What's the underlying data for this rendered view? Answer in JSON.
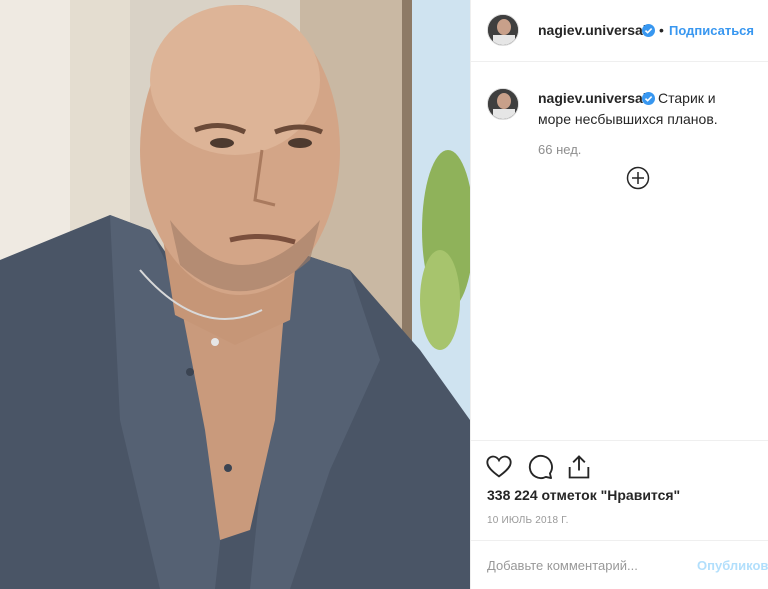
{
  "header": {
    "username": "nagiev.universal",
    "separator": "•",
    "follow_label": "Подписаться"
  },
  "post": {
    "username": "nagiev.universal",
    "caption": "Старик и море несбывшихся планов.",
    "time_ago": "66 нед."
  },
  "actions": {
    "likes_text": "338 224 отметок \"Нравится\"",
    "date": "10 ИЮЛЬ 2018 Г."
  },
  "comment": {
    "placeholder": "Добавьте комментарий...",
    "publish_label": "Опубликовать"
  },
  "colors": {
    "accent": "#3897f0",
    "verified": "#3897f0",
    "muted": "#8e8e8e"
  },
  "icons": [
    "verified-icon",
    "add-icon",
    "heart-icon",
    "comment-icon",
    "share-icon"
  ]
}
